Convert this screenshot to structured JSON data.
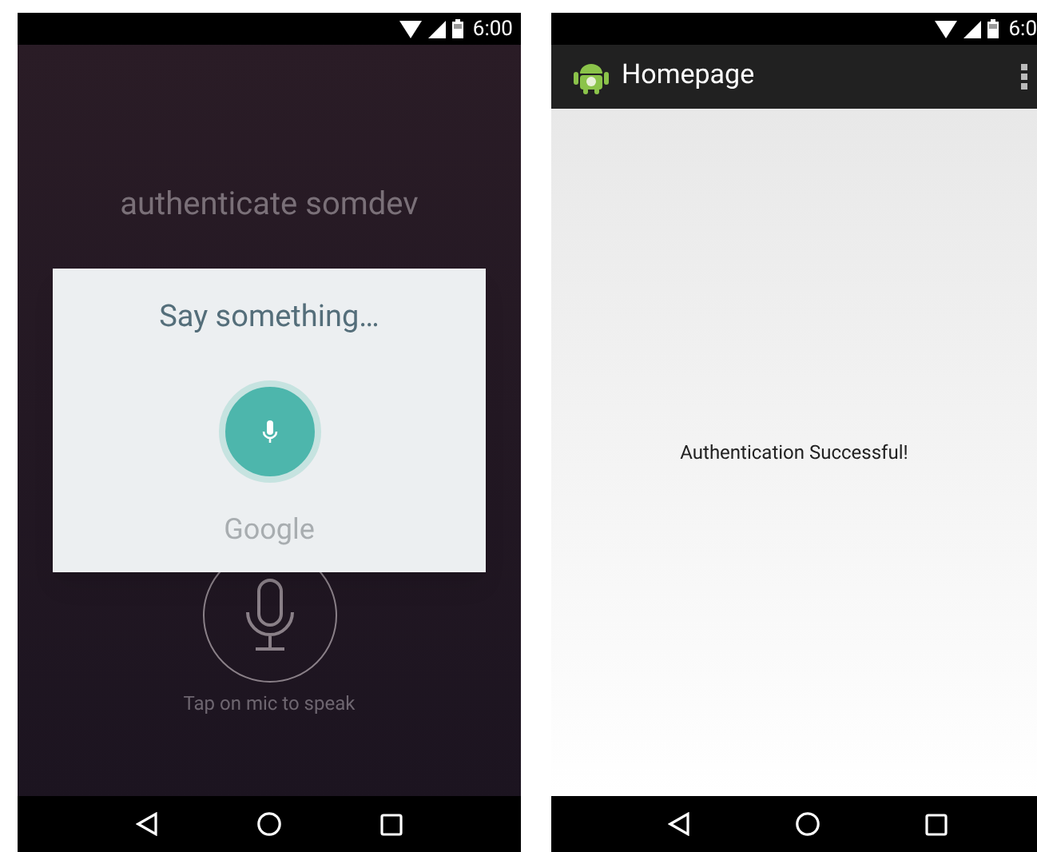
{
  "voice_screen": {
    "status_bar": {
      "time": "6:00"
    },
    "query_text": "authenticate somdev",
    "hint": "Tap on mic to speak",
    "dialog": {
      "title": "Say something…",
      "brand": "Google"
    }
  },
  "home_screen": {
    "status_bar": {
      "time": "6:0"
    },
    "app_bar": {
      "title": "Homepage"
    },
    "message": "Authentication Successful!"
  }
}
